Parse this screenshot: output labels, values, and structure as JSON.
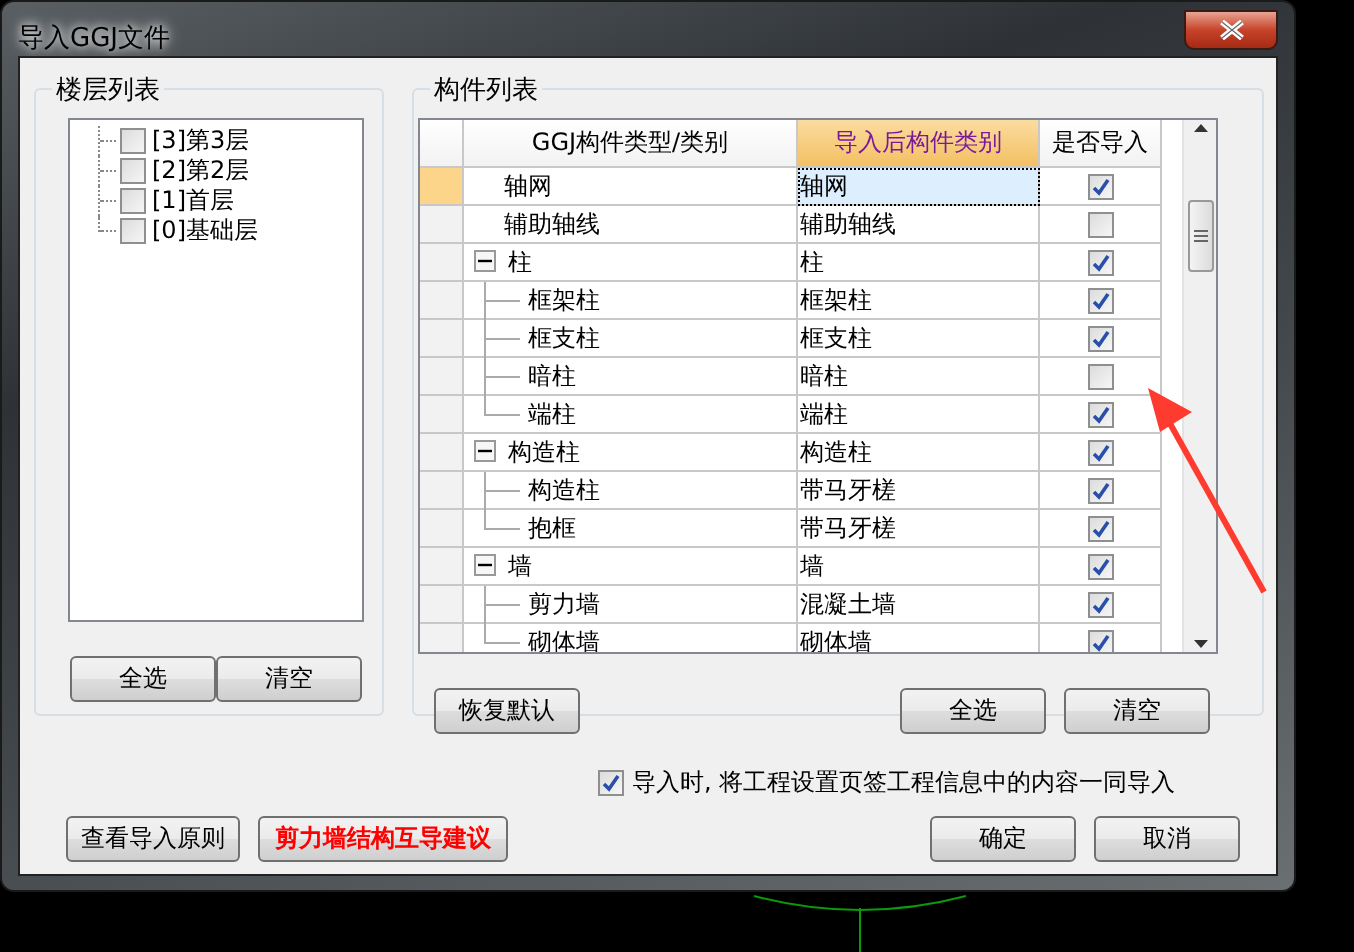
{
  "window": {
    "title": "导入GGJ文件"
  },
  "floor_panel": {
    "title": "楼层列表",
    "floors": [
      {
        "label": "[3]第3层",
        "checked": false
      },
      {
        "label": "[2]第2层",
        "checked": false
      },
      {
        "label": "[1]首层",
        "checked": false
      },
      {
        "label": "[0]基础层",
        "checked": false
      }
    ],
    "buttons": [
      "全选",
      "清空"
    ]
  },
  "component_panel": {
    "title": "构件列表",
    "columns": [
      "GGJ构件类型/类别",
      "导入后构件类别",
      "是否导入"
    ],
    "rows": [
      {
        "name": "轴网",
        "target": "轴网",
        "import": true,
        "selected": true
      },
      {
        "name": "辅助轴线",
        "target": "辅助轴线",
        "import": false,
        "selected": false
      },
      {
        "name": "柱",
        "target": "柱",
        "import": true,
        "selected": false,
        "expanded": true,
        "children": [
          {
            "name": "框架柱",
            "target": "框架柱",
            "import": true,
            "selected": false
          },
          {
            "name": "框支柱",
            "target": "框支柱",
            "import": true,
            "selected": false
          },
          {
            "name": "暗柱",
            "target": "暗柱",
            "import": false,
            "selected": false
          },
          {
            "name": "端柱",
            "target": "端柱",
            "import": true,
            "selected": false
          }
        ]
      },
      {
        "name": "构造柱",
        "target": "构造柱",
        "import": true,
        "selected": false,
        "expanded": true,
        "children": [
          {
            "name": "构造柱",
            "target": "带马牙槎",
            "import": true,
            "selected": false
          },
          {
            "name": "抱框",
            "target": "带马牙槎",
            "import": true,
            "selected": false
          }
        ]
      },
      {
        "name": "墙",
        "target": "墙",
        "import": true,
        "selected": false,
        "expanded": true,
        "children": [
          {
            "name": "剪力墙",
            "target": "混凝土墙",
            "import": true,
            "selected": false
          },
          {
            "name": "砌体墙",
            "target": "砌体墙",
            "import": true,
            "selected": false
          }
        ]
      }
    ],
    "left_buttons": [
      "恢复默认"
    ],
    "right_buttons": [
      "全选",
      "清空"
    ]
  },
  "import_project_info": {
    "label": "导入时, 将工程设置页签工程信息中的内容一同导入",
    "checked": true
  },
  "footer": {
    "left_buttons": [
      {
        "label": "查看导入原则",
        "kind": "normal"
      },
      {
        "label": "剪力墙结构互导建议",
        "kind": "warning"
      }
    ],
    "right_buttons": [
      "确定",
      "取消"
    ]
  }
}
